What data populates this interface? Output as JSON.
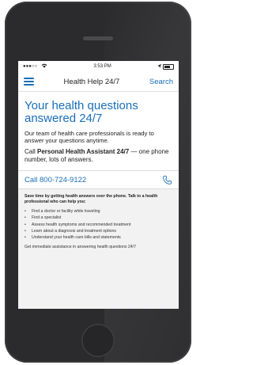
{
  "statusbar": {
    "signal": "●●●○○",
    "time": "3:53 PM"
  },
  "navbar": {
    "title": "Health Help 24/7",
    "search": "Search"
  },
  "hero": {
    "headline": "Your health questions answered 24/7",
    "body": "Our team of health care professionals is ready to answer your questions anytime.",
    "call_prefix": "Call ",
    "call_bold": "Personal Health Assistant 24/7",
    "call_suffix": " — one phone number, lots of answers."
  },
  "call": {
    "phone": "Call 800-724-9122"
  },
  "info": {
    "intro": "Save time by getting health answers over the phone. Talk to a health professional who can help you:",
    "bullet": "•",
    "items": [
      "Find a doctor or facility while traveling",
      "Find a specialist",
      "Assess health symptoms and recommended treatment",
      "Learn about a diagnosis and treatment options",
      "Understand your health care bills and statements"
    ],
    "footer": "Get immediate assistance in answering health questions 24/7"
  },
  "colors": {
    "accent": "#1a6fb8",
    "phone_body": "#2b2b2d"
  },
  "icons": {
    "menu": "hamburger-icon",
    "phone": "phone-icon",
    "wifi": "wifi-icon",
    "location": "location-arrow-icon",
    "battery": "battery-icon"
  }
}
